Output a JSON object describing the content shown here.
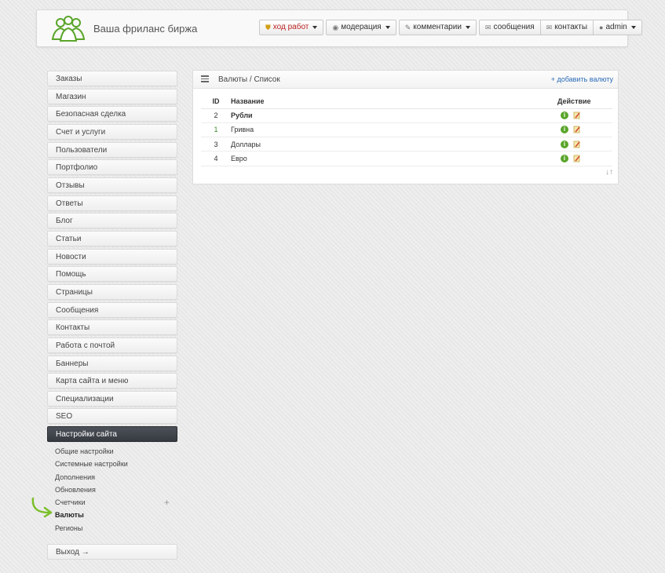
{
  "header": {
    "title": "Ваша фриланс биржа",
    "nav": {
      "work": "ход работ",
      "moderation": "модерация",
      "comments": "комментарии",
      "messages": "сообщения",
      "contacts": "контакты",
      "user": "admin"
    }
  },
  "sidebar": {
    "items": [
      "Заказы",
      "Магазин",
      "Безопасная сделка",
      "Счет и услуги",
      "Пользователи",
      "Портфолио",
      "Отзывы",
      "Ответы",
      "Блог",
      "Статьи",
      "Новости",
      "Помощь",
      "Страницы",
      "Сообщения",
      "Контакты",
      "Работа с почтой",
      "Баннеры",
      "Карта сайта и меню",
      "Специализации",
      "SEO"
    ],
    "active": "Настройки сайта",
    "submenu": [
      "Общие настройки",
      "Системные настройки",
      "Дополнения",
      "Обновления",
      "Счетчики",
      "Валюты",
      "Регионы"
    ],
    "logout": "Выход →"
  },
  "panel": {
    "breadcrumb": "Валюты / Список",
    "add_link": "+ добавить валюту",
    "columns": {
      "id": "ID",
      "name": "Название",
      "action": "Действие"
    },
    "rows": [
      {
        "id": "2",
        "name": "Рубли"
      },
      {
        "id": "1",
        "name": "Гривна"
      },
      {
        "id": "3",
        "name": "Доллары"
      },
      {
        "id": "4",
        "name": "Евро"
      }
    ],
    "sort_glyph": "↓↑"
  },
  "colors": {
    "accent_green": "#5aa52a",
    "link": "#2a6cb8",
    "active_bg": "#3f434a"
  }
}
